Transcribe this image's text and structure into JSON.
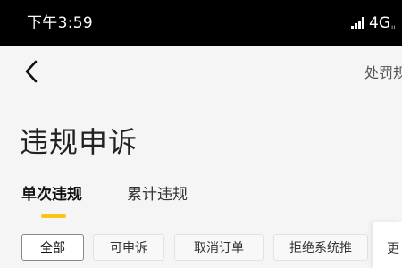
{
  "status_bar": {
    "time": "下午3:59",
    "network": "4G",
    "network_sub": "ıı"
  },
  "nav": {
    "back_icon": "chevron-left-icon",
    "right_link": "处罚规"
  },
  "page": {
    "title": "违规申诉"
  },
  "tabs": [
    {
      "label": "单次违规",
      "active": true
    },
    {
      "label": "累计违规",
      "active": false
    }
  ],
  "filters": [
    {
      "label": "全部",
      "selected": true
    },
    {
      "label": "可申诉",
      "selected": false
    },
    {
      "label": "取消订单",
      "selected": false
    },
    {
      "label": "拒绝系统推",
      "selected": false
    }
  ],
  "more": {
    "label": "更"
  },
  "colors": {
    "accent": "#f5c518",
    "status_bar_bg": "#000000",
    "page_bg": "#f5f5f5"
  }
}
